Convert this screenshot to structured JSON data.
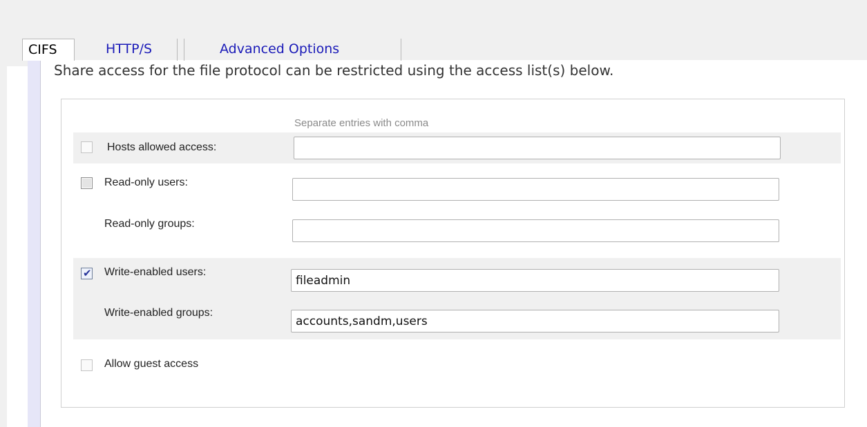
{
  "tabs": [
    {
      "label": "CIFS",
      "active": true
    },
    {
      "label": "HTTP/S",
      "active": false
    },
    {
      "label": "Advanced Options",
      "active": false
    }
  ],
  "intro_text": "Share access for the file protocol can be restricted using the access list(s) below.",
  "hint_text": "Separate entries with comma",
  "rows": {
    "hosts": {
      "label": "Hosts allowed access:",
      "checked": false,
      "value": ""
    },
    "ro_users": {
      "label": "Read-only users:",
      "checked": false,
      "value": ""
    },
    "ro_groups": {
      "label": "Read-only groups:",
      "value": ""
    },
    "we_users": {
      "label": "Write-enabled users:",
      "checked": true,
      "value": "fileadmin"
    },
    "we_groups": {
      "label": "Write-enabled groups:",
      "value": "accounts,sandm,users"
    },
    "guest": {
      "label": "Allow guest access",
      "checked": false
    }
  },
  "colors": {
    "tab_link": "#1a1ab8",
    "band_bg": "#f0f0f0",
    "pane_border": "#e6e6f8"
  }
}
